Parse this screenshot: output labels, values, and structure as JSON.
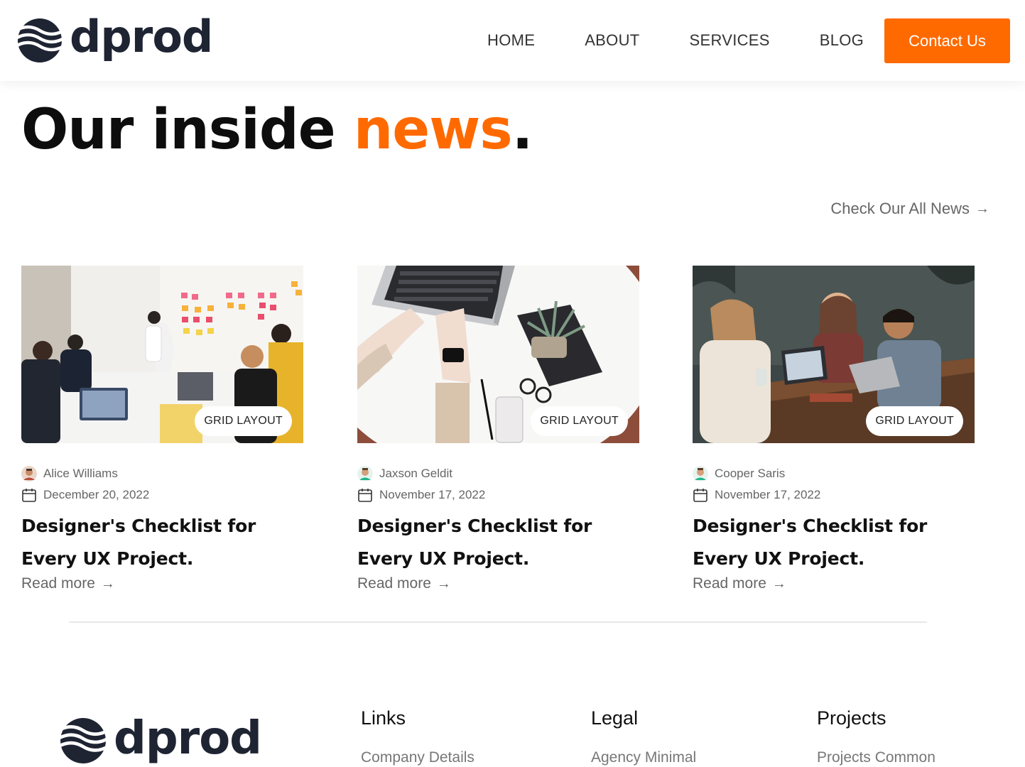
{
  "brand": {
    "name": "dprod"
  },
  "nav": {
    "items": [
      "HOME",
      "ABOUT",
      "SERVICES",
      "BLOG"
    ],
    "contact_label": "Contact Us"
  },
  "hero": {
    "title_part1": "Our inside ",
    "title_accent": "news",
    "title_end": "."
  },
  "all_news_label": "Check Our All News",
  "cards": [
    {
      "image": "team-meeting-photo",
      "tag": "GRID LAYOUT",
      "author": "Alice Williams",
      "date": "December 20, 2022",
      "title": "Designer's Checklist for Every UX Project.",
      "read_more": "Read more"
    },
    {
      "image": "laptop-typing-photo",
      "tag": "GRID LAYOUT",
      "author": "Jaxson Geldit",
      "date": "November 17, 2022",
      "title": "Designer's Checklist for Every UX Project.",
      "read_more": "Read more"
    },
    {
      "image": "cafe-friends-photo",
      "tag": "GRID LAYOUT",
      "author": "Cooper Saris",
      "date": "November 17, 2022",
      "title": "Designer's Checklist for Every UX Project.",
      "read_more": "Read more"
    }
  ],
  "footer": {
    "columns": [
      {
        "heading": "Links",
        "items": [
          "Company Details"
        ]
      },
      {
        "heading": "Legal",
        "items": [
          "Agency Minimal"
        ]
      },
      {
        "heading": "Projects",
        "items": [
          "Projects Common"
        ]
      }
    ]
  },
  "colors": {
    "accent": "#ff6a00",
    "brand_dark": "#1f2433",
    "muted": "#666666"
  }
}
